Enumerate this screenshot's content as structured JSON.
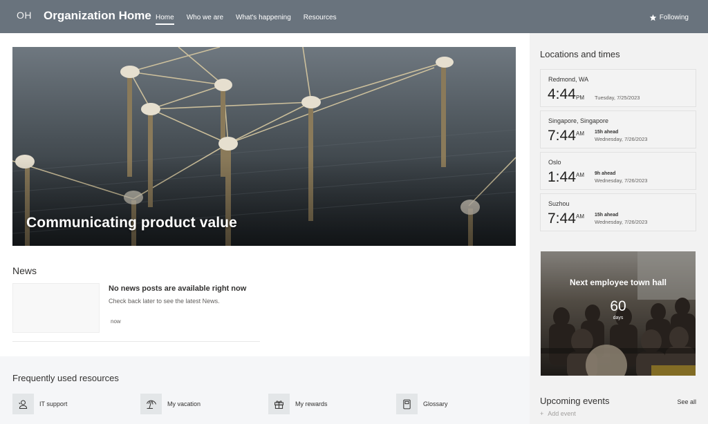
{
  "header": {
    "logo_initials": "OH",
    "site_title": "Organization Home",
    "nav": [
      "Home",
      "Who we are",
      "What's happening",
      "Resources"
    ],
    "active_nav": "Home",
    "follow_label": "Following",
    "follow_icon": "star-icon"
  },
  "hero": {
    "title": "Communicating product value"
  },
  "news": {
    "heading": "News",
    "empty_title": "No news posts are available right now",
    "empty_subtitle": "Check back later to see the latest News.",
    "time": "now"
  },
  "resources": {
    "heading": "Frequently used resources",
    "items": [
      {
        "label": "IT support",
        "icon": "support-person-icon"
      },
      {
        "label": "My vacation",
        "icon": "beach-umbrella-icon"
      },
      {
        "label": "My rewards",
        "icon": "gift-icon"
      },
      {
        "label": "Glossary",
        "icon": "book-icon"
      }
    ]
  },
  "locations": {
    "heading": "Locations and times",
    "clocks": [
      {
        "city": "Redmond, WA",
        "time": "4:44",
        "ampm": "PM",
        "ahead": "",
        "date": "Tuesday, 7/25/2023"
      },
      {
        "city": "Singapore, Singapore",
        "time": "7:44",
        "ampm": "AM",
        "ahead": "15h ahead",
        "date": "Wednesday, 7/26/2023"
      },
      {
        "city": "Oslo",
        "time": "1:44",
        "ampm": "AM",
        "ahead": "9h ahead",
        "date": "Wednesday, 7/26/2023"
      },
      {
        "city": "Suzhou",
        "time": "7:44",
        "ampm": "AM",
        "ahead": "15h ahead",
        "date": "Wednesday, 7/26/2023"
      }
    ]
  },
  "townhall": {
    "title": "Next employee town hall",
    "count": "60",
    "unit": "days"
  },
  "events": {
    "heading": "Upcoming events",
    "see_all": "See all",
    "add_event": "Add event"
  },
  "colors": {
    "header_bg": "#69737d",
    "side_bg": "#f2f2f2",
    "resources_bg": "#f5f6f8"
  }
}
